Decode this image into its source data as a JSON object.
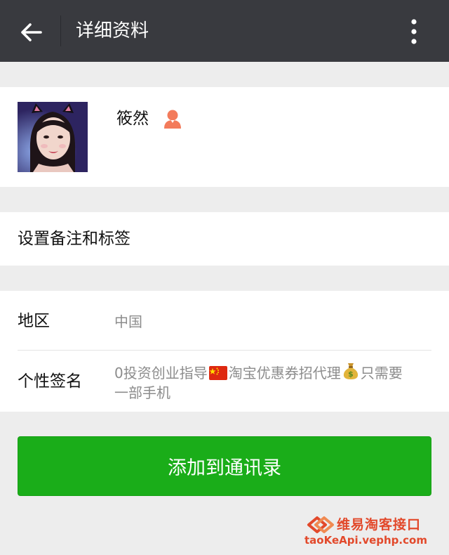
{
  "header": {
    "title": "详细资料"
  },
  "profile": {
    "nickname": "筱然",
    "gender": "female"
  },
  "remark": {
    "label": "设置备注和标签"
  },
  "info": {
    "region_label": "地区",
    "region_value": "中国",
    "signature_label": "个性签名",
    "signature_part1": "0投资创业指导",
    "signature_part2": "淘宝优惠券招代理",
    "signature_part3": "只需要",
    "signature_part4": "一部手机"
  },
  "actions": {
    "add_contact_label": "添加到通讯录"
  },
  "watermark": {
    "name": "维易淘客接口",
    "url": "taoKeApi.vephp.com"
  },
  "colors": {
    "topbar": "#393a3f",
    "primary_green": "#1aad19",
    "gender_icon": "#f37b5b",
    "watermark": "#e2492b"
  },
  "icons": {
    "back": "arrow-left-icon",
    "more": "more-vertical-icon",
    "gender": "female-person-icon",
    "flag": "china-flag-icon",
    "money_bag": "money-bag-icon"
  }
}
